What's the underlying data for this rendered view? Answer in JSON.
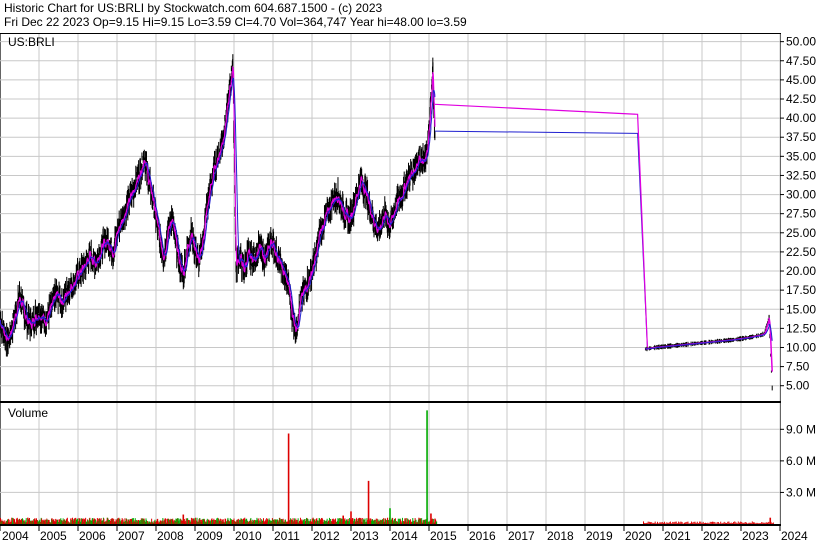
{
  "header": {
    "line1": "Historic Chart for US:BRLI by Stockwatch.com 604.687.1500 - (c) 2023",
    "line2": "Fri Dec 22 2023   Op=9.15  Hi=9.15  Lo=3.59  Cl=4.70  Vol=364,747  Year hi=48.00  lo=3.59"
  },
  "chart_data": [
    {
      "type": "line",
      "symbol_label": "US:BRLI",
      "y_ticks": [
        "50.00",
        "47.50",
        "45.00",
        "42.50",
        "40.00",
        "37.50",
        "35.00",
        "32.50",
        "30.00",
        "27.50",
        "25.00",
        "22.50",
        "20.00",
        "17.50",
        "15.00",
        "12.50",
        "10.00",
        "7.50",
        "5.00"
      ],
      "ylim": [
        3.0,
        51.0
      ],
      "x_ticks": [
        "2004",
        "2005",
        "2006",
        "2007",
        "2008",
        "2009",
        "2010",
        "2011",
        "2012",
        "2013",
        "2014",
        "2015",
        "2016",
        "2017",
        "2018",
        "2019",
        "2020",
        "2021",
        "2022",
        "2023",
        "2024"
      ],
      "xlim": [
        2004.0,
        2024.0
      ],
      "grid": true,
      "colors": {
        "price": "#000000",
        "ma_short": "#e000e0",
        "ma_long": "#2020d0"
      },
      "price_points": [
        [
          2004.0,
          13.5
        ],
        [
          2004.1,
          12.0
        ],
        [
          2004.2,
          11.0
        ],
        [
          2004.3,
          12.5
        ],
        [
          2004.4,
          14.5
        ],
        [
          2004.5,
          16.5
        ],
        [
          2004.6,
          15.0
        ],
        [
          2004.7,
          13.5
        ],
        [
          2004.8,
          13.0
        ],
        [
          2004.9,
          14.0
        ],
        [
          2005.0,
          14.5
        ],
        [
          2005.15,
          13.5
        ],
        [
          2005.3,
          15.0
        ],
        [
          2005.45,
          17.0
        ],
        [
          2005.6,
          16.0
        ],
        [
          2005.75,
          17.5
        ],
        [
          2005.9,
          18.5
        ],
        [
          2006.0,
          19.5
        ],
        [
          2006.15,
          20.5
        ],
        [
          2006.3,
          22.0
        ],
        [
          2006.45,
          21.0
        ],
        [
          2006.6,
          23.0
        ],
        [
          2006.75,
          24.0
        ],
        [
          2006.9,
          22.5
        ],
        [
          2007.0,
          25.0
        ],
        [
          2007.15,
          27.0
        ],
        [
          2007.3,
          29.0
        ],
        [
          2007.45,
          31.0
        ],
        [
          2007.6,
          33.0
        ],
        [
          2007.7,
          35.0
        ],
        [
          2007.8,
          32.0
        ],
        [
          2007.9,
          30.0
        ],
        [
          2008.0,
          27.0
        ],
        [
          2008.1,
          24.0
        ],
        [
          2008.2,
          22.0
        ],
        [
          2008.3,
          25.0
        ],
        [
          2008.4,
          27.0
        ],
        [
          2008.5,
          24.0
        ],
        [
          2008.6,
          21.0
        ],
        [
          2008.7,
          19.5
        ],
        [
          2008.8,
          23.0
        ],
        [
          2008.9,
          25.0
        ],
        [
          2009.0,
          23.0
        ],
        [
          2009.1,
          21.0
        ],
        [
          2009.2,
          24.0
        ],
        [
          2009.3,
          28.0
        ],
        [
          2009.4,
          31.0
        ],
        [
          2009.5,
          33.5
        ],
        [
          2009.6,
          35.0
        ],
        [
          2009.7,
          37.0
        ],
        [
          2009.8,
          40.0
        ],
        [
          2009.9,
          44.0
        ],
        [
          2009.97,
          47.5
        ],
        [
          2010.05,
          20.5
        ],
        [
          2010.15,
          22.0
        ],
        [
          2010.25,
          20.0
        ],
        [
          2010.35,
          22.0
        ],
        [
          2010.5,
          21.5
        ],
        [
          2010.65,
          23.0
        ],
        [
          2010.8,
          21.5
        ],
        [
          2010.95,
          24.0
        ],
        [
          2011.1,
          22.0
        ],
        [
          2011.25,
          20.0
        ],
        [
          2011.4,
          18.0
        ],
        [
          2011.5,
          14.0
        ],
        [
          2011.6,
          12.5
        ],
        [
          2011.7,
          16.0
        ],
        [
          2011.85,
          18.0
        ],
        [
          2012.0,
          20.0
        ],
        [
          2012.1,
          22.0
        ],
        [
          2012.2,
          25.0
        ],
        [
          2012.35,
          27.0
        ],
        [
          2012.5,
          29.0
        ],
        [
          2012.65,
          30.0
        ],
        [
          2012.8,
          28.0
        ],
        [
          2012.95,
          26.5
        ],
        [
          2013.1,
          29.0
        ],
        [
          2013.25,
          32.0
        ],
        [
          2013.4,
          30.0
        ],
        [
          2013.55,
          27.0
        ],
        [
          2013.7,
          25.0
        ],
        [
          2013.85,
          27.5
        ],
        [
          2014.0,
          26.0
        ],
        [
          2014.15,
          28.5
        ],
        [
          2014.3,
          30.0
        ],
        [
          2014.45,
          32.0
        ],
        [
          2014.6,
          33.0
        ],
        [
          2014.75,
          35.0
        ],
        [
          2014.9,
          34.0
        ],
        [
          2015.0,
          38.0
        ],
        [
          2015.05,
          42.0
        ],
        [
          2015.1,
          46.5
        ],
        [
          2015.15,
          37.0
        ]
      ],
      "gap_lines": {
        "ma_short": [
          [
            2015.15,
            41.8
          ],
          [
            2020.35,
            40.5
          ],
          [
            2020.6,
            10.0
          ]
        ],
        "ma_long": [
          [
            2015.15,
            38.3
          ],
          [
            2020.35,
            38.0
          ],
          [
            2020.6,
            10.0
          ]
        ]
      },
      "late_points": [
        [
          2020.55,
          9.8
        ],
        [
          2020.8,
          10.0
        ],
        [
          2021.2,
          10.2
        ],
        [
          2021.6,
          10.4
        ],
        [
          2022.0,
          10.6
        ],
        [
          2022.4,
          10.8
        ],
        [
          2022.8,
          11.0
        ],
        [
          2023.2,
          11.3
        ],
        [
          2023.5,
          11.6
        ],
        [
          2023.6,
          11.8
        ],
        [
          2023.72,
          14.0
        ],
        [
          2023.76,
          9.0
        ],
        [
          2023.8,
          4.7
        ]
      ]
    },
    {
      "type": "bar",
      "panel_label": "Volume",
      "y_ticks": [
        "9.0 M",
        "6.0 M",
        "3.0 M"
      ],
      "ylim": [
        0,
        11.5
      ],
      "colors": {
        "up": "#00aa00",
        "down": "#dd0000"
      },
      "spikes": [
        {
          "x": 2008.7,
          "v": 0.9,
          "dir": "down"
        },
        {
          "x": 2011.4,
          "v": 8.6,
          "dir": "down"
        },
        {
          "x": 2012.8,
          "v": 0.8,
          "dir": "down"
        },
        {
          "x": 2013.0,
          "v": 1.2,
          "dir": "down"
        },
        {
          "x": 2013.45,
          "v": 4.1,
          "dir": "down"
        },
        {
          "x": 2014.0,
          "v": 1.5,
          "dir": "up"
        },
        {
          "x": 2014.95,
          "v": 10.8,
          "dir": "up"
        },
        {
          "x": 2015.05,
          "v": 1.0,
          "dir": "down"
        },
        {
          "x": 2023.75,
          "v": 0.6,
          "dir": "down"
        }
      ]
    }
  ]
}
